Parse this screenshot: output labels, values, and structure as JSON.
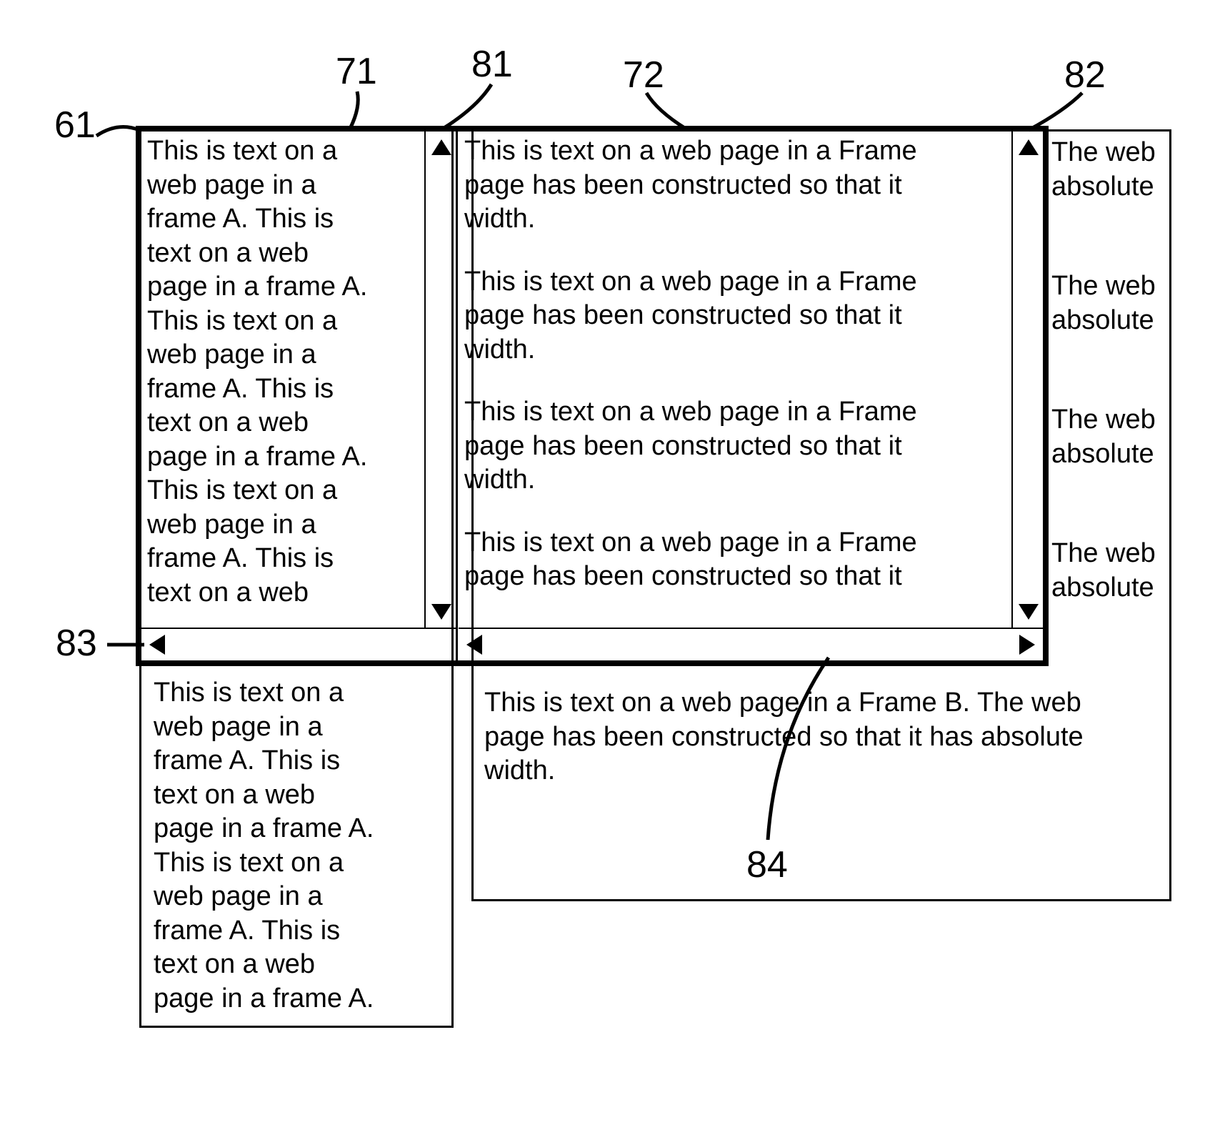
{
  "labels": {
    "l61": "61",
    "l71": "71",
    "l81": "81",
    "l72": "72",
    "l82": "82",
    "l83": "83",
    "l84": "84"
  },
  "pageA": {
    "text": "This is text on a\nweb page in a\nframe A. This is\ntext on a web\npage in a frame A.\nThis is text on a\nweb page in a\nframe A. This is\ntext on a web\npage in a frame A.\nThis is text on a\nweb page in a\nframe A. This is\ntext on a web"
  },
  "pageA_below": {
    "text": "This is text on a\nweb page in a\nframe A. This is\ntext on a web\npage in a frame A.\nThis is text on a\nweb page in a\nframe A. This is\ntext on a web\npage in a frame A."
  },
  "pageB": {
    "paras": [
      "This is text on a web page in a Frame\npage has been constructed so that it\nwidth.",
      "This is text on a web page in a Frame\npage has been constructed so that it\nwidth.",
      "This is text on a web page in a Frame\npage has been constructed so that it\nwidth.",
      "This is text on a web page in a Frame\npage has been constructed so that it"
    ],
    "strip": [
      "The web\nabsolute",
      "The web\nabsolute",
      "The web\nabsolute",
      "The web\nabsolute"
    ],
    "below": "This is text on a web page in a Frame B. The web\npage has been constructed so that it has absolute\nwidth."
  }
}
